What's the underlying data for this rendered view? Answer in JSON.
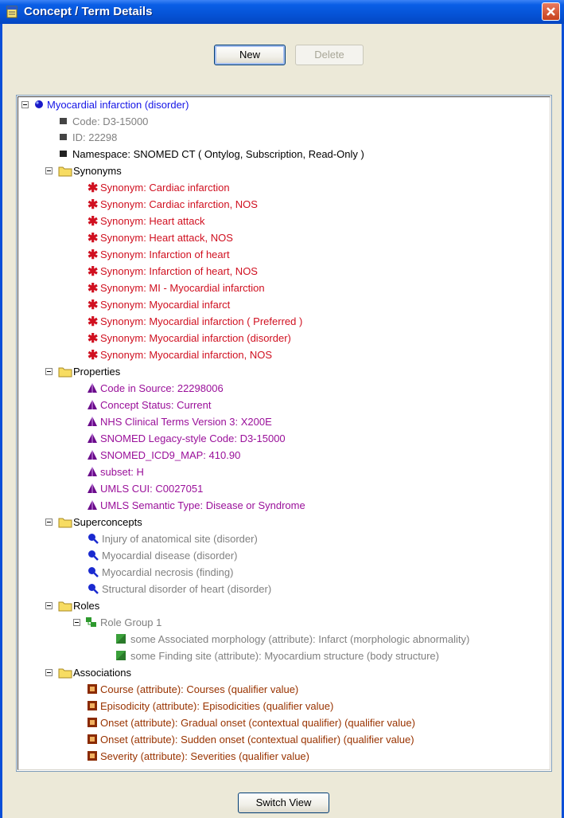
{
  "window": {
    "title": "Concept / Term Details"
  },
  "toolbar": {
    "new_label": "New",
    "delete_label": "Delete"
  },
  "tree": {
    "root": "Myocardial infarction (disorder)",
    "code": "Code:  D3-15000",
    "id": "ID:  22298",
    "namespace": "Namespace:  SNOMED CT ( Ontylog, Subscription, Read-Only )",
    "synonyms_label": "Synonyms",
    "synonyms": [
      "Synonym: Cardiac infarction",
      "Synonym: Cardiac infarction, NOS",
      "Synonym: Heart attack",
      "Synonym: Heart attack, NOS",
      "Synonym: Infarction of heart",
      "Synonym: Infarction of heart, NOS",
      "Synonym: MI - Myocardial infarction",
      "Synonym: Myocardial infarct",
      "Synonym: Myocardial infarction ( Preferred )",
      "Synonym: Myocardial infarction (disorder)",
      "Synonym: Myocardial infarction, NOS"
    ],
    "properties_label": "Properties",
    "properties": [
      "Code in Source:  22298006",
      "Concept Status:  Current",
      "NHS Clinical Terms Version 3:  X200E",
      "SNOMED Legacy-style Code:  D3-15000",
      "SNOMED_ICD9_MAP:  410.90",
      "subset:  H",
      "UMLS CUI:  C0027051",
      "UMLS Semantic Type:  Disease or Syndrome"
    ],
    "superconcepts_label": "Superconcepts",
    "superconcepts": [
      "Injury of anatomical site (disorder)",
      "Myocardial disease (disorder)",
      "Myocardial necrosis (finding)",
      "Structural disorder of heart (disorder)"
    ],
    "roles_label": "Roles",
    "role_group": "Role Group 1",
    "roles": [
      "some Associated morphology (attribute):  Infarct (morphologic abnormality)",
      "some Finding site (attribute):  Myocardium structure (body structure)"
    ],
    "associations_label": "Associations",
    "associations": [
      "Course (attribute): Courses (qualifier value)",
      "Episodicity (attribute): Episodicities (qualifier value)",
      "Onset (attribute): Gradual onset (contextual qualifier) (qualifier value)",
      "Onset (attribute): Sudden onset (contextual qualifier) (qualifier value)",
      "Severity (attribute): Severities (qualifier value)"
    ]
  },
  "footer": {
    "switch_view_label": "Switch View"
  },
  "colors": {
    "root": "#1414e6",
    "synonym": "#d01020",
    "property": "#9a109a",
    "association": "#993300",
    "muted": "#808080",
    "titlebar": "#0553d6"
  }
}
